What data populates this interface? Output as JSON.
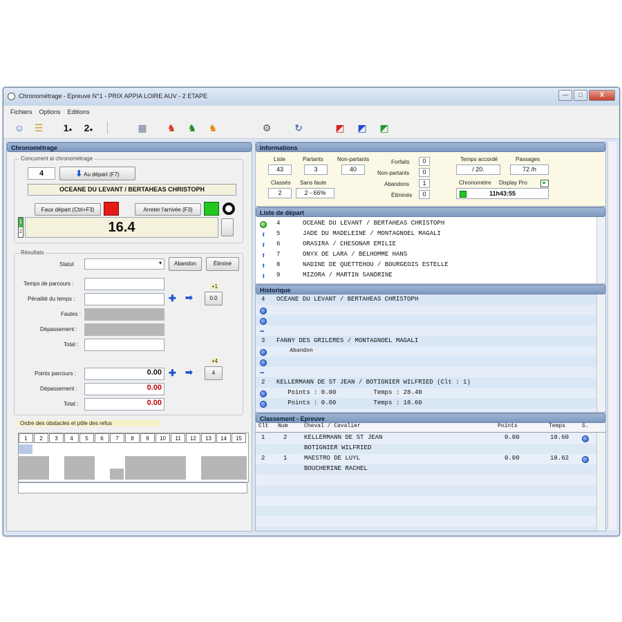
{
  "window": {
    "title": "Chronométrage - Epreuve N°1 - PRIX APPIA LOIRE AUV - 2 ETAPE",
    "controls": {
      "minimize": "—",
      "maximize": "□",
      "close": "X"
    }
  },
  "menu": [
    "Fichiers",
    "Options",
    "Editions"
  ],
  "toolbar": {
    "icons": [
      "users-icon",
      "list-icon",
      "first-icon",
      "second-icon",
      "calculator-icon",
      "rider-red-icon",
      "rider-green-icon",
      "rider-orange-icon",
      "settings-icon",
      "refresh-icon",
      "flag-red-icon",
      "flag-blue-icon",
      "flag-green-icon"
    ],
    "labels": {
      "first": "1",
      "second": "2"
    }
  },
  "chrono": {
    "header": "Chronométrage",
    "group_label": "Concurrent al chronométrage",
    "competitor_number": "4",
    "depart_button": "Au départ (F7)",
    "competitor_name": "OCEANE DU LEVANT / BERTAHEAS CHRISTOPH",
    "faux_depart": "Faux départ (Ctrl+F3)",
    "arreter": "Arreter l'arrivée (F3)",
    "time_display": "16.4",
    "marks": [
      "1",
      "2"
    ],
    "colors": {
      "red_light": "#e41b17",
      "green_light": "#22c81f"
    }
  },
  "results": {
    "group_label": "Résultats",
    "statut_label": "Statut",
    "statut_value": "",
    "abandon": "Abandon",
    "elimine": "Éliminé",
    "temps_parcours": "Temps de parcours",
    "penalite_temps": "Pénalité du temps",
    "fautes": "Fautes",
    "depassement": "Dépassement",
    "total": "Total",
    "penalite_value": "0.0",
    "plus1": "+1",
    "points_parcours": "Points parcours",
    "points_parcours_value": "0.00",
    "depassement_value": "0.00",
    "total_value": "0.00",
    "plus4": "+4",
    "minus4": "4"
  },
  "obstacles": {
    "label": "Ordre des obstacles et pôle des refus",
    "numbers": [
      "1",
      "2",
      "3",
      "4",
      "5",
      "6",
      "7",
      "8",
      "9",
      "10",
      "11",
      "12",
      "13",
      "14",
      "15"
    ]
  },
  "informations": {
    "header": "Informations",
    "liste": {
      "label": "Liste",
      "value": "43"
    },
    "partants": {
      "label": "Partants",
      "value": "3"
    },
    "non_partants": {
      "label": "Non-partants",
      "value": "40"
    },
    "classes": {
      "label": "Classés",
      "value": "2"
    },
    "sans_faute": {
      "label": "Sans faute",
      "value": "2 - 66%"
    },
    "forfaits": {
      "label": "Forfaits",
      "value": "0"
    },
    "non_partants2": {
      "label": "Non-partants",
      "value": "0"
    },
    "abandons": {
      "label": "Abandons",
      "value": "1"
    },
    "elimines": {
      "label": "Éliminés",
      "value": "0"
    },
    "temps_accorde": {
      "label": "Temps accordé",
      "value": "/ 20."
    },
    "passages": {
      "label": "Passages",
      "value": "72 /h"
    },
    "chronometre": {
      "label": "Chronomètre",
      "value": "11h43:55"
    },
    "display_pro": "Display Pro"
  },
  "liste_depart": {
    "header": "Liste de départ",
    "rows": [
      {
        "icon": "green",
        "num": "4",
        "name": "OCEANE DU LEVANT / BERTAHEAS CHRISTOPH"
      },
      {
        "icon": "arrow",
        "num": "5",
        "name": "JADE DU MADELEINE / MONTAGNOEL MAGALI"
      },
      {
        "icon": "arrow",
        "num": "6",
        "name": "ORASIRA / CHESONAR EMILIE"
      },
      {
        "icon": "arrow",
        "num": "7",
        "name": "ONYX DE LARA / BELHOMME HANS"
      },
      {
        "icon": "arrow",
        "num": "8",
        "name": "NADINE DE QUETTEHOU / BOURGEOIS ESTELLE"
      },
      {
        "icon": "arrow",
        "num": "9",
        "name": "MIZORA / MARTIN SANDRINE"
      }
    ]
  },
  "historique": {
    "header": "Historique",
    "rows": [
      {
        "num": "4",
        "icon": "",
        "text": "OCEANE DU LEVANT / BERTAHEAS CHRISTOPH"
      },
      {
        "num": "",
        "icon": "blue",
        "text": ""
      },
      {
        "num": "",
        "icon": "blue",
        "text": ""
      },
      {
        "num": "",
        "icon": "arrow",
        "text": ""
      },
      {
        "num": "3",
        "icon": "",
        "text": "FANNY DES GRILERES / MONTAGNOEL MAGALI"
      },
      {
        "num": "",
        "icon": "blue",
        "text": "    Abandon"
      },
      {
        "num": "",
        "icon": "blue",
        "text": ""
      },
      {
        "num": "",
        "icon": "arrow",
        "text": ""
      },
      {
        "num": "2",
        "icon": "",
        "text": "KELLERMANN DE ST JEAN / BOTIGNIER WILFRIED (Clt : 1)"
      },
      {
        "num": "",
        "icon": "blue",
        "text": "   Points : 0.00          Temps : 28.40"
      },
      {
        "num": "",
        "icon": "blue",
        "text": "   Points : 0.00          Temps : 18.60"
      }
    ]
  },
  "classement": {
    "header": "Classement - Epreuve",
    "columns": [
      "Clt",
      "Num",
      "Cheval / Cavalier",
      "Points",
      "Temps",
      "S."
    ],
    "rows": [
      {
        "clt": "1",
        "num": "2",
        "horse": "KELLERMANN DE ST JEAN",
        "rider": "BOTIGNIER WILFRIED",
        "points": "0.00",
        "temps": "18.60"
      },
      {
        "clt": "2",
        "num": "1",
        "horse": "MAESTRO DE LUYL",
        "rider": "BOUCHERINE RACHEL",
        "points": "0.00",
        "temps": "18.62"
      }
    ]
  }
}
